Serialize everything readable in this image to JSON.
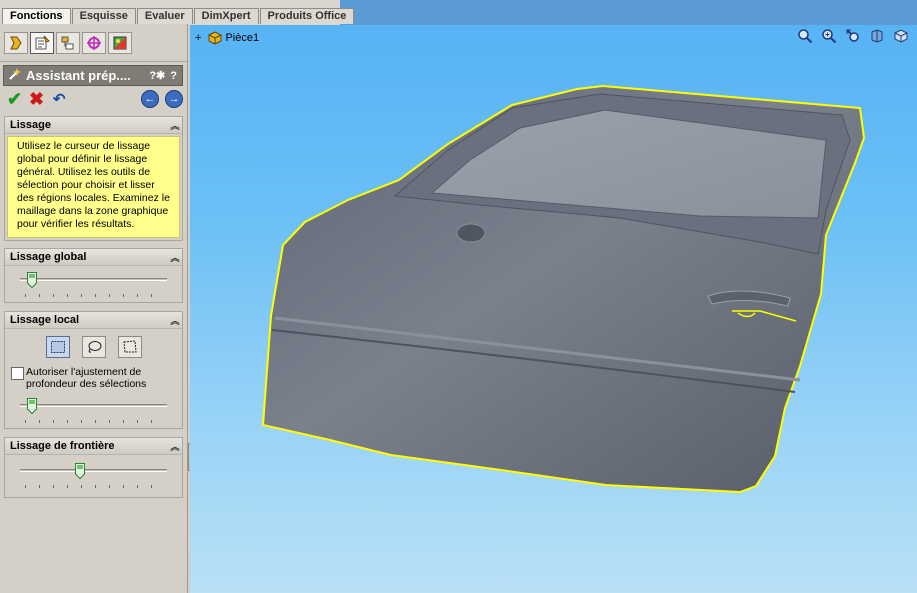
{
  "tabs": [
    {
      "label": "Fonctions"
    },
    {
      "label": "Esquisse"
    },
    {
      "label": "Evaluer"
    },
    {
      "label": "DimXpert"
    },
    {
      "label": "Produits Office"
    }
  ],
  "property_manager": {
    "title": "Assistant prép....",
    "help_label": "?",
    "sections": {
      "lissage": {
        "title": "Lissage",
        "note": "Utilisez le curseur de lissage global pour définir le lissage général. Utilisez les outils de sélection pour choisir et lisser des régions locales. Examinez le maillage dans la zone graphique pour vérifier les résultats."
      },
      "lissage_global": {
        "title": "Lissage global",
        "slider_level": 0.05
      },
      "lissage_local": {
        "title": "Lissage local",
        "checkbox_label": "Autoriser l'ajustement de profondeur des sélections",
        "checkbox_checked": false,
        "slider_level": 0.05
      },
      "lissage_frontiere": {
        "title": "Lissage de frontière",
        "slider_level": 0.4
      }
    }
  },
  "tree": {
    "root_label": "Pièce1",
    "expand_symbol": "+"
  },
  "icons": {
    "panel_tabs": [
      "feature-manager-icon",
      "property-manager-icon",
      "configuration-manager-icon",
      "dimxpert-manager-icon",
      "display-manager-icon"
    ],
    "view_tools": [
      "zoom-to-fit-icon",
      "zoom-area-icon",
      "previous-view-icon",
      "section-view-icon",
      "view-orientation-icon"
    ]
  },
  "colors": {
    "viewport_top": "#57b3f4",
    "viewport_bottom": "#b8e0f6",
    "mesh": "#707683",
    "boundary": "#ffff00",
    "note_bg": "#ffff8c"
  }
}
